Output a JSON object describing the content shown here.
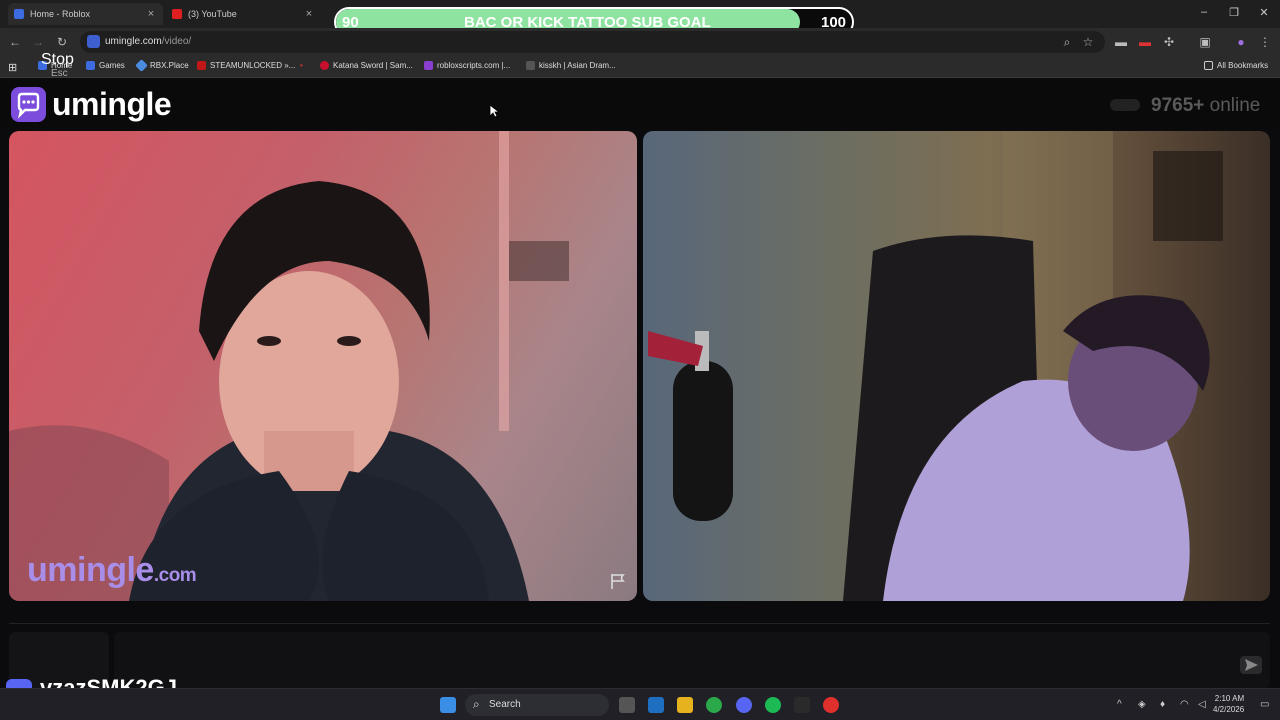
{
  "browser": {
    "tabs": [
      {
        "label": "Home - Roblox",
        "close": "×"
      },
      {
        "label": "(3) YouTube",
        "close": "×"
      }
    ],
    "url_host": "umingle.com",
    "url_path": "/video/",
    "bookmarks": [
      {
        "label": "Home"
      },
      {
        "label": "Games"
      },
      {
        "label": "RBX.Place"
      },
      {
        "label": "STEAMUNLOCKED »..."
      },
      {
        "label": "Katana Sword | Sam..."
      },
      {
        "label": "robloxscripts.com |..."
      },
      {
        "label": "kisskh | Asian Dram..."
      }
    ],
    "all_bookmarks": "All Bookmarks"
  },
  "overlay": {
    "goal_current": "90",
    "goal_label": "BAC OR KICK TATTOO SUB GOAL",
    "goal_target": "100",
    "goal_progress": 0.9,
    "discord_handle": "vzazSMK2GJ"
  },
  "site": {
    "logo": "umingle",
    "online_count": "9765+",
    "online_word": "online",
    "watermark": "umingle",
    "watermark_domain": ".com"
  },
  "controls": {
    "stop_label": "Stop",
    "stop_shortcut": "Esc"
  },
  "taskbar": {
    "search_placeholder": "Search",
    "time": "2:10 AM",
    "date": "4/2/2026"
  }
}
